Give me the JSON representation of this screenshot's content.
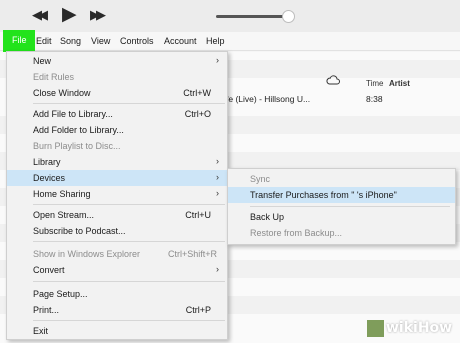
{
  "player": {
    "icons": {
      "prev": "rewind-icon",
      "play": "play-icon",
      "next": "fast-forward-icon"
    },
    "prev_glyph": "◀◀",
    "play_glyph": "▶",
    "next_glyph": "▶▶",
    "volume_level": 0.9
  },
  "menubar": {
    "items": [
      "File",
      "Edit",
      "Song",
      "View",
      "Controls",
      "Account",
      "Help"
    ],
    "highlight_color": "#22e31b"
  },
  "library": {
    "columns": {
      "time": "Time",
      "artist": "Artist"
    },
    "cloud_icon": "cloud-icon",
    "rows": [
      {
        "song": "fe (Live) - Hillsong U...",
        "time": "8:38"
      }
    ]
  },
  "file_menu": {
    "items": [
      {
        "label": "New",
        "submenu": true
      },
      {
        "label": "Edit Rules",
        "disabled": true
      },
      {
        "label": "Close Window",
        "shortcut": "Ctrl+W"
      },
      {
        "label": "Add File to Library...",
        "shortcut": "Ctrl+O"
      },
      {
        "label": "Add Folder to Library..."
      },
      {
        "label": "Burn Playlist to Disc...",
        "disabled": true
      },
      {
        "label": "Library",
        "submenu": true
      },
      {
        "label": "Devices",
        "submenu": true,
        "highlighted": true
      },
      {
        "label": "Home Sharing",
        "submenu": true
      },
      {
        "label": "Open Stream...",
        "shortcut": "Ctrl+U"
      },
      {
        "label": "Subscribe to Podcast..."
      },
      {
        "label": "Show in Windows Explorer",
        "shortcut": "Ctrl+Shift+R",
        "disabled": true
      },
      {
        "label": "Convert",
        "submenu": true
      },
      {
        "label": "Page Setup..."
      },
      {
        "label": "Print...",
        "shortcut": "Ctrl+P"
      },
      {
        "label": "Exit"
      }
    ],
    "arrow_glyph": "›"
  },
  "devices_submenu": {
    "items": [
      {
        "label": "Sync",
        "disabled": true
      },
      {
        "label": "Transfer Purchases from \"       's iPhone\"",
        "highlighted": true
      },
      {
        "label": "Back Up"
      },
      {
        "label": "Restore from Backup...",
        "disabled": true
      }
    ]
  },
  "watermark": {
    "text": "wikiHow"
  },
  "colors": {
    "highlight": "#cde5f7",
    "file_highlight": "#22e31b",
    "disabled_text": "#8c8c8c"
  }
}
